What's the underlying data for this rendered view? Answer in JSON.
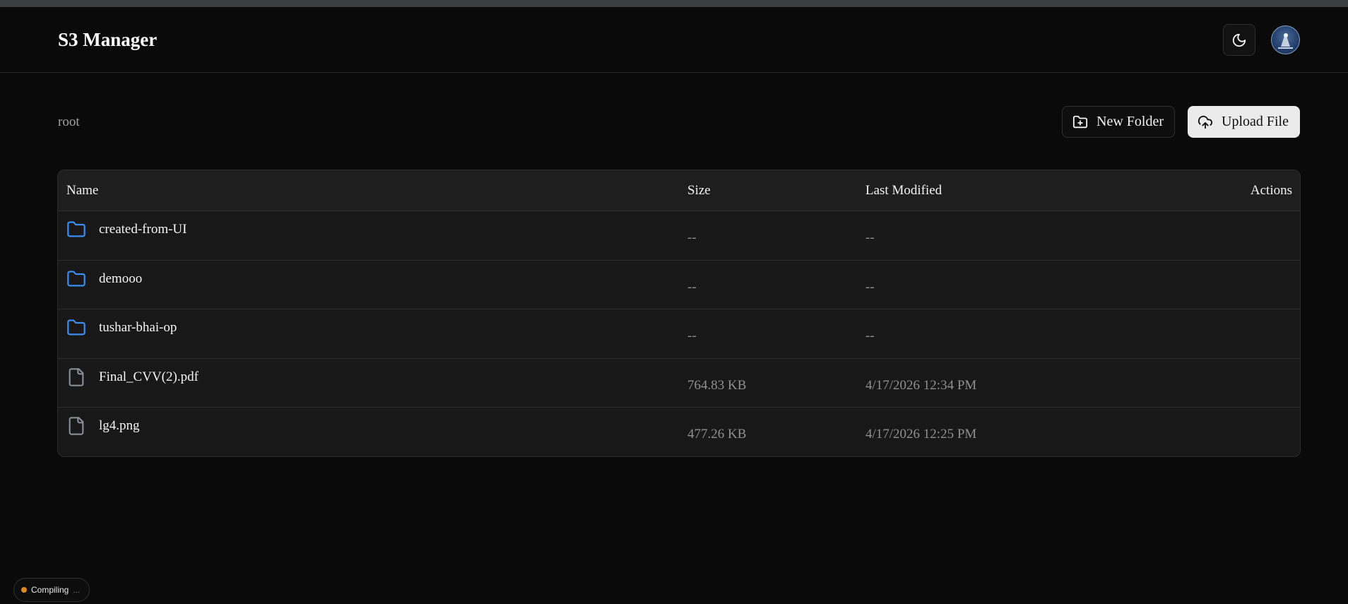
{
  "header": {
    "title": "S3 Manager",
    "theme_toggle_icon": "moon-icon",
    "avatar_icon": "user-avatar"
  },
  "breadcrumb": {
    "path": "root"
  },
  "toolbar": {
    "new_folder_label": "New Folder",
    "new_folder_icon": "folder-plus-icon",
    "upload_label": "Upload File",
    "upload_icon": "cloud-upload-icon"
  },
  "table": {
    "columns": {
      "name": "Name",
      "size": "Size",
      "modified": "Last Modified",
      "actions": "Actions"
    },
    "rows": [
      {
        "type": "folder",
        "name": "created-from-UI",
        "size": "--",
        "modified": "--"
      },
      {
        "type": "folder",
        "name": "demooo",
        "size": "--",
        "modified": "--"
      },
      {
        "type": "folder",
        "name": "tushar-bhai-op",
        "size": "--",
        "modified": "--"
      },
      {
        "type": "file",
        "name": "Final_CVV(2).pdf",
        "size": "764.83 KB",
        "modified": "4/17/2026 12:34 PM"
      },
      {
        "type": "file",
        "name": "lg4.png",
        "size": "477.26 KB",
        "modified": "4/17/2026 12:25 PM"
      }
    ]
  },
  "status": {
    "label": "Compiling",
    "ellipsis": "...",
    "color": "#e08a1e"
  },
  "colors": {
    "folder": "#3b8ef0",
    "file": "#8a8f96",
    "background": "#0a0a0a"
  }
}
